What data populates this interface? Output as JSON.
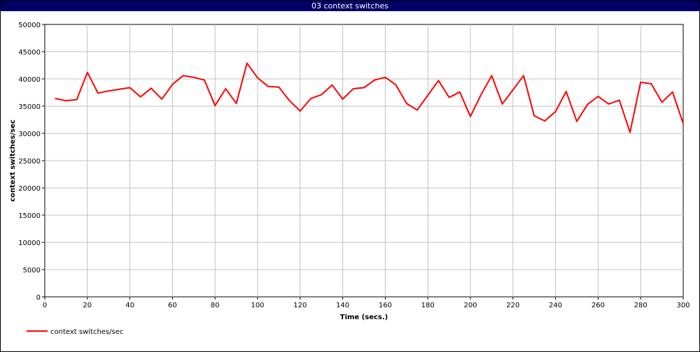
{
  "window": {
    "title": "03 context switches"
  },
  "chart_data": {
    "type": "line",
    "title": "03 context switches",
    "xlabel": "Time (secs.)",
    "ylabel": "context switches/sec",
    "xlim": [
      0,
      300
    ],
    "ylim": [
      0,
      50000
    ],
    "xticks": [
      0,
      20,
      40,
      60,
      80,
      100,
      120,
      140,
      160,
      180,
      200,
      220,
      240,
      260,
      280,
      300
    ],
    "yticks": [
      0,
      5000,
      10000,
      15000,
      20000,
      25000,
      30000,
      35000,
      40000,
      45000,
      50000
    ],
    "grid": true,
    "legend_position": "bottom-left",
    "series": [
      {
        "name": "context switches/sec",
        "color": "#ff0000",
        "x": [
          5,
          10,
          15,
          20,
          25,
          30,
          35,
          40,
          45,
          50,
          55,
          60,
          65,
          70,
          75,
          80,
          85,
          90,
          95,
          100,
          105,
          110,
          115,
          120,
          125,
          130,
          135,
          140,
          145,
          150,
          155,
          160,
          165,
          170,
          175,
          180,
          185,
          190,
          195,
          200,
          205,
          210,
          215,
          220,
          225,
          230,
          235,
          240,
          245,
          250,
          255,
          260,
          265,
          270,
          275,
          280,
          285,
          290,
          295,
          300
        ],
        "y": [
          36400,
          36000,
          36200,
          41200,
          37400,
          37800,
          38100,
          38400,
          36700,
          38300,
          36300,
          39000,
          40600,
          40300,
          39800,
          35100,
          38200,
          35500,
          42900,
          40200,
          38600,
          38500,
          36000,
          34100,
          36400,
          37100,
          38900,
          36300,
          38200,
          38400,
          39800,
          40300,
          38900,
          35500,
          34300,
          37000,
          39700,
          36600,
          37600,
          33100,
          37100,
          40600,
          35400,
          38000,
          40600,
          33200,
          32300,
          34000,
          37700,
          32200,
          35300,
          36800,
          35400,
          36100,
          30200,
          39400,
          39100,
          35700,
          37600,
          31800
        ]
      }
    ]
  }
}
